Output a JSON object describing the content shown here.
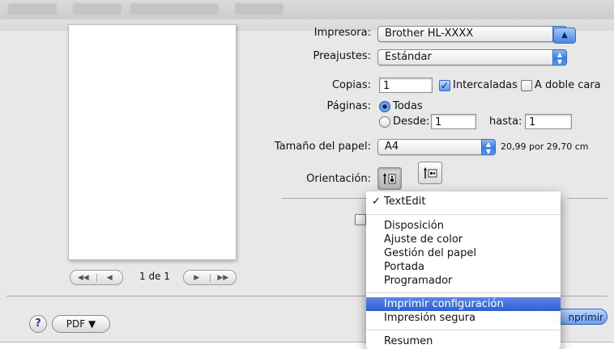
{
  "printer": {
    "label": "Impresora:",
    "value": "Brother HL-XXXX"
  },
  "presets": {
    "label": "Preajustes:",
    "value": "Estándar"
  },
  "copies": {
    "label": "Copias:",
    "value": "1",
    "collate_label": "Intercaladas",
    "collate_checked": true,
    "duplex_label": "A doble cara",
    "duplex_checked": false
  },
  "pages": {
    "label": "Páginas:",
    "all_label": "Todas",
    "from_label": "Desde:",
    "from_value": "1",
    "to_label": "hasta:",
    "to_value": "1",
    "selected": "all"
  },
  "paper_size": {
    "label": "Tamaño del papel:",
    "value": "A4",
    "dimensions": "20,99 por 29,70 cm"
  },
  "orientation": {
    "label": "Orientación:"
  },
  "preview": {
    "page_indicator": "1 de 1"
  },
  "footer": {
    "pdf_label": "PDF ▼",
    "help_label": "?",
    "print_label": "nprimir"
  },
  "menu": {
    "header_item": "TextEdit",
    "group1": [
      "Disposición",
      "Ajuste de color",
      "Gestión del papel",
      "Portada",
      "Programador"
    ],
    "group2": [
      "Imprimir configuración",
      "Impresión segura"
    ],
    "group3": [
      "Resumen"
    ],
    "highlighted": "Imprimir configuración"
  },
  "colors": {
    "accent": "#3a6fd8",
    "dialog_bg": "#e8e8e8"
  }
}
